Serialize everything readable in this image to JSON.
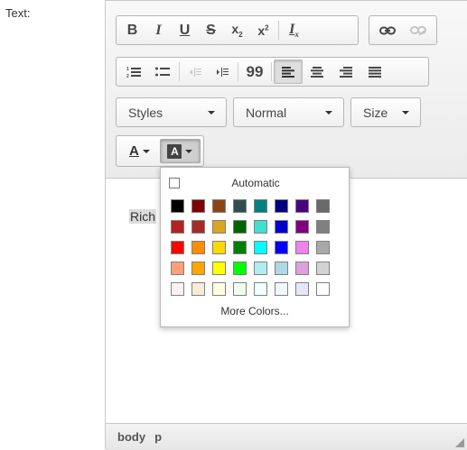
{
  "field_label": "Text:",
  "toolbar": {
    "bold_label": "B",
    "italic_label": "I",
    "underline_label": "U",
    "strike_label": "S",
    "subscript_label": "x",
    "subscript_mark": "2",
    "superscript_label": "x",
    "superscript_mark": "2",
    "remove_format_label": "I",
    "remove_format_mark": "x",
    "blockquote_label": "99",
    "styles_label": "Styles",
    "format_label": "Normal",
    "size_label": "Size",
    "text_color_label": "A",
    "bg_color_label": "A",
    "icons": [
      "bold-icon",
      "italic-icon",
      "underline-icon",
      "strikethrough-icon",
      "subscript-icon",
      "superscript-icon",
      "remove-format-icon",
      "link-icon",
      "unlink-icon",
      "numbered-list-icon",
      "bulleted-list-icon",
      "outdent-icon",
      "indent-icon",
      "blockquote-icon",
      "align-left-icon",
      "align-center-icon",
      "align-right-icon",
      "justify-icon",
      "text-color-icon",
      "background-color-icon"
    ]
  },
  "content": {
    "text": "Rich"
  },
  "statusbar": {
    "path": [
      "body",
      "p"
    ]
  },
  "color_panel": {
    "automatic_label": "Automatic",
    "more_colors_label": "More Colors...",
    "colors": [
      [
        "#000000",
        "#800000",
        "#8b4513",
        "#2f4f4f",
        "#008080",
        "#000080",
        "#4b0082",
        "#696969"
      ],
      [
        "#b22222",
        "#a52a2a",
        "#daa520",
        "#006400",
        "#40e0d0",
        "#0000cd",
        "#800080",
        "#808080"
      ],
      [
        "#ff0000",
        "#ff8c00",
        "#ffd700",
        "#008000",
        "#00ffff",
        "#0000ff",
        "#ee82ee",
        "#a9a9a9"
      ],
      [
        "#ffa07a",
        "#ffa500",
        "#ffff00",
        "#00ff00",
        "#afeeee",
        "#add8e6",
        "#dda0dd",
        "#d3d3d3"
      ],
      [
        "#fff0f5",
        "#faebd7",
        "#ffffe0",
        "#f0fff0",
        "#f0ffff",
        "#f0f8ff",
        "#e6e6fa",
        "#ffffff"
      ]
    ]
  }
}
